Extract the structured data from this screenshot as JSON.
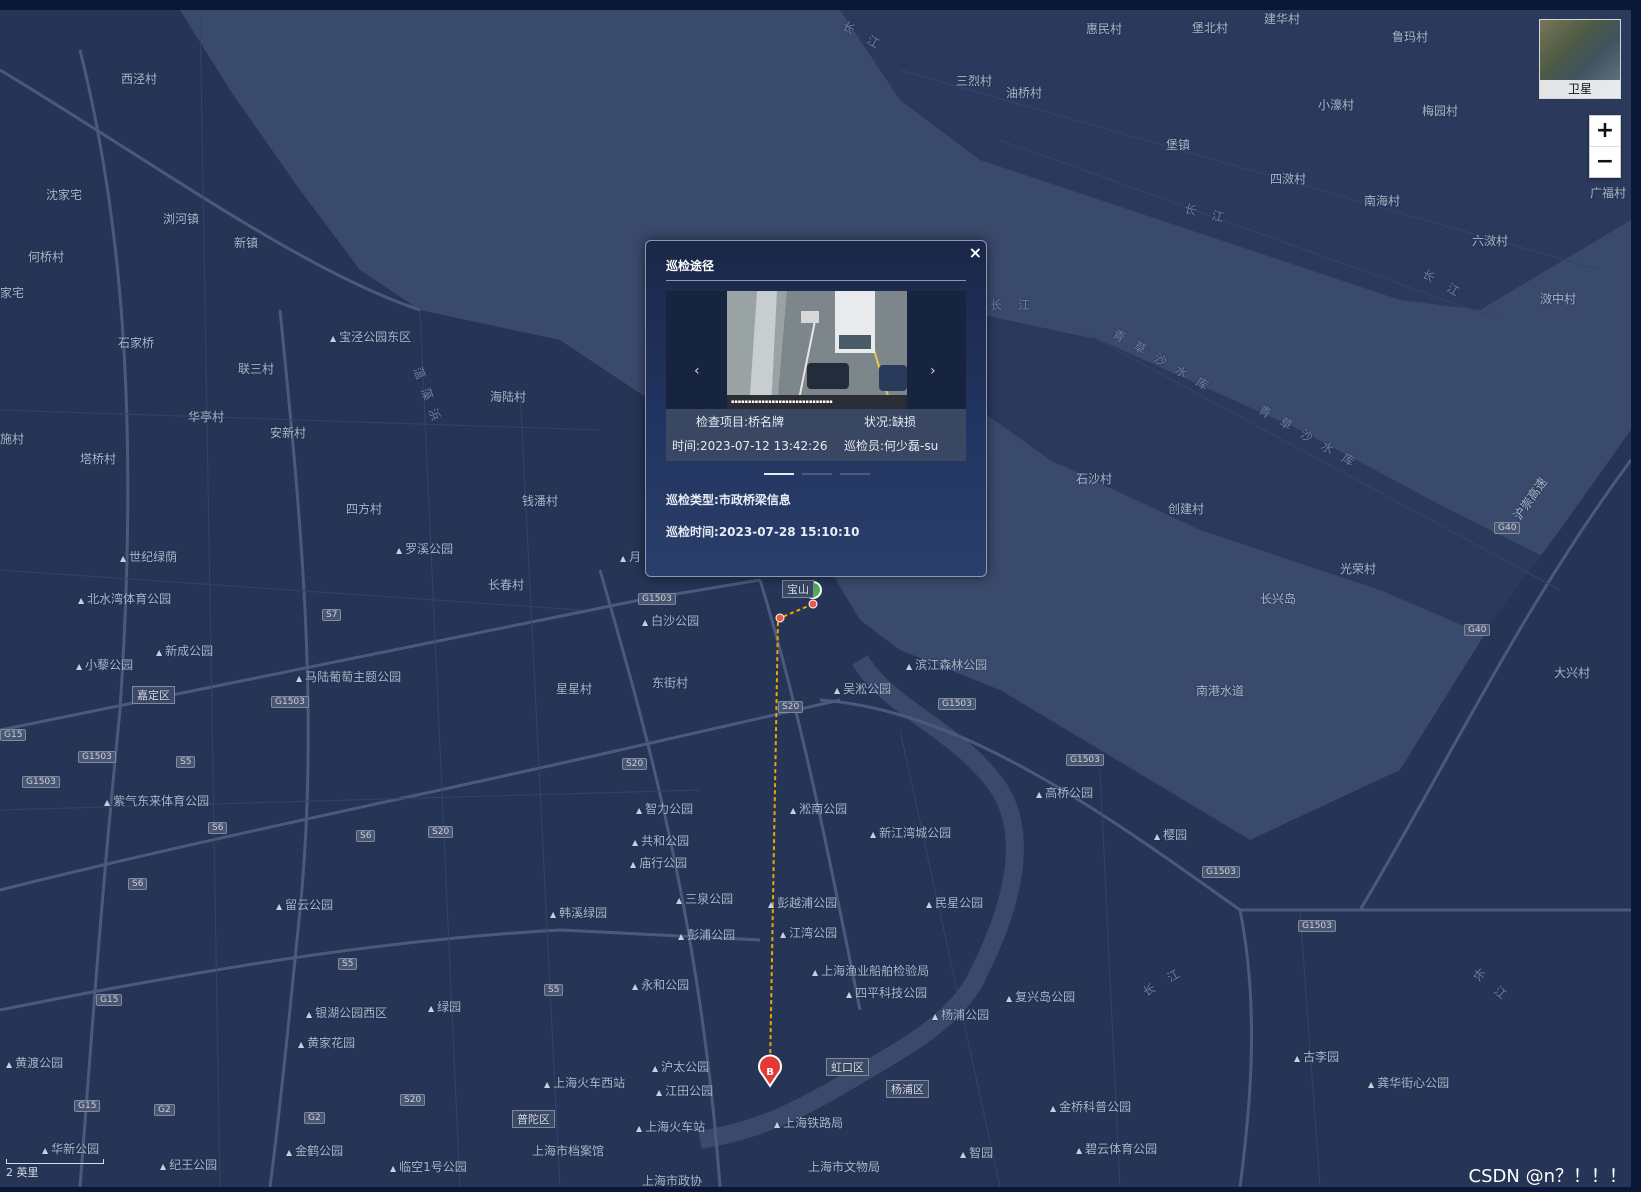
{
  "map": {
    "places": [
      {
        "name": "西泾村",
        "kind": "village"
      },
      {
        "name": "沈家宅",
        "kind": "village"
      },
      {
        "name": "浏河镇",
        "kind": "village"
      },
      {
        "name": "新镇",
        "kind": "village"
      },
      {
        "name": "何桥村",
        "kind": "village"
      },
      {
        "name": "家宅",
        "kind": "village"
      },
      {
        "name": "石家桥",
        "kind": "village"
      },
      {
        "name": "联三村",
        "kind": "village"
      },
      {
        "name": "宝泾公园东区",
        "kind": "poi"
      },
      {
        "name": "海陆村",
        "kind": "village"
      },
      {
        "name": "华亭村",
        "kind": "village"
      },
      {
        "name": "安新村",
        "kind": "village"
      },
      {
        "name": "施村",
        "kind": "village"
      },
      {
        "name": "塔桥村",
        "kind": "village"
      },
      {
        "name": "四方村",
        "kind": "village"
      },
      {
        "name": "钱潘村",
        "kind": "village"
      },
      {
        "name": "世纪绿荫",
        "kind": "poi"
      },
      {
        "name": "罗溪公园",
        "kind": "poi"
      },
      {
        "name": "长春村",
        "kind": "village"
      },
      {
        "name": "北水湾体育公园",
        "kind": "poi"
      },
      {
        "name": "白沙公园",
        "kind": "poi"
      },
      {
        "name": "小藜公园",
        "kind": "poi"
      },
      {
        "name": "新成公园",
        "kind": "poi"
      },
      {
        "name": "马陆葡萄主题公园",
        "kind": "poi"
      },
      {
        "name": "东街村",
        "kind": "village"
      },
      {
        "name": "星星村",
        "kind": "village"
      },
      {
        "name": "滨江森林公园",
        "kind": "poi"
      },
      {
        "name": "吴淞公园",
        "kind": "poi"
      },
      {
        "name": "紫气东来体育公园",
        "kind": "poi"
      },
      {
        "name": "智力公园",
        "kind": "poi"
      },
      {
        "name": "共和公园",
        "kind": "poi"
      },
      {
        "name": "庙行公园",
        "kind": "poi"
      },
      {
        "name": "淞南公园",
        "kind": "poi"
      },
      {
        "name": "新江湾城公园",
        "kind": "poi"
      },
      {
        "name": "高桥公园",
        "kind": "poi"
      },
      {
        "name": "留云公园",
        "kind": "poi"
      },
      {
        "name": "韩溪绿园",
        "kind": "poi"
      },
      {
        "name": "三泉公园",
        "kind": "poi"
      },
      {
        "name": "彭越浦公园",
        "kind": "poi"
      },
      {
        "name": "彭浦公园",
        "kind": "poi"
      },
      {
        "name": "江湾公园",
        "kind": "poi"
      },
      {
        "name": "民星公园",
        "kind": "poi"
      },
      {
        "name": "上海渔业船舶检验局",
        "kind": "poi"
      },
      {
        "name": "四平科技公园",
        "kind": "poi"
      },
      {
        "name": "杨浦公园",
        "kind": "poi"
      },
      {
        "name": "复兴岛公园",
        "kind": "poi"
      },
      {
        "name": "永和公园",
        "kind": "poi"
      },
      {
        "name": "银湖公园西区",
        "kind": "poi"
      },
      {
        "name": "绿园",
        "kind": "poi"
      },
      {
        "name": "黄家花园",
        "kind": "poi"
      },
      {
        "name": "黄渡公园",
        "kind": "poi"
      },
      {
        "name": "沪太公园",
        "kind": "poi"
      },
      {
        "name": "上海火车西站",
        "kind": "poi"
      },
      {
        "name": "江田公园",
        "kind": "poi"
      },
      {
        "name": "上海火车站",
        "kind": "poi"
      },
      {
        "name": "上海铁路局",
        "kind": "poi"
      },
      {
        "name": "金桥科普公园",
        "kind": "poi"
      },
      {
        "name": "碧云体育公园",
        "kind": "poi"
      },
      {
        "name": "古李园",
        "kind": "poi"
      },
      {
        "name": "龚华街心公园",
        "kind": "poi"
      },
      {
        "name": "华新公园",
        "kind": "poi"
      },
      {
        "name": "金鹤公园",
        "kind": "poi"
      },
      {
        "name": "纪王公园",
        "kind": "poi"
      },
      {
        "name": "临空1号公园",
        "kind": "poi"
      },
      {
        "name": "上海市档案馆",
        "kind": "poi"
      },
      {
        "name": "上海市文物局",
        "kind": "poi"
      },
      {
        "name": "上海市政协",
        "kind": "poi"
      },
      {
        "name": "智园",
        "kind": "poi"
      },
      {
        "name": "惠民村",
        "kind": "village"
      },
      {
        "name": "堡北村",
        "kind": "village"
      },
      {
        "name": "建华村",
        "kind": "village"
      },
      {
        "name": "鲁玛村",
        "kind": "village"
      },
      {
        "name": "三烈村",
        "kind": "village"
      },
      {
        "name": "油桥村",
        "kind": "village"
      },
      {
        "name": "小濠村",
        "kind": "village"
      },
      {
        "name": "梅园村",
        "kind": "village"
      },
      {
        "name": "堡镇",
        "kind": "village"
      },
      {
        "name": "四滧村",
        "kind": "village"
      },
      {
        "name": "南海村",
        "kind": "village"
      },
      {
        "name": "广福村",
        "kind": "village"
      },
      {
        "name": "六滧村",
        "kind": "village"
      },
      {
        "name": "滧中村",
        "kind": "village"
      },
      {
        "name": "石沙村",
        "kind": "village"
      },
      {
        "name": "创建村",
        "kind": "village"
      },
      {
        "name": "光荣村",
        "kind": "village"
      },
      {
        "name": "长兴岛",
        "kind": "village"
      },
      {
        "name": "南港水道",
        "kind": "village"
      },
      {
        "name": "大兴村",
        "kind": "village"
      },
      {
        "name": "樱园",
        "kind": "poi"
      },
      {
        "name": "月",
        "kind": "poi"
      }
    ],
    "districts": [
      "嘉定区",
      "宝山",
      "虹口区",
      "杨浦区",
      "普陀区"
    ],
    "rivers": [
      "长江",
      "长江",
      "长江",
      "长江",
      "长江",
      "青草沙水库",
      "青草沙水库",
      "蕰藻浜",
      "长江",
      "沪崇高速"
    ],
    "road_shields": [
      "G1503",
      "S7",
      "G1503",
      "G1503",
      "S20",
      "S20",
      "G1503",
      "S5",
      "S6",
      "S6",
      "S20",
      "S6",
      "S5",
      "S5",
      "G15",
      "G15",
      "G2",
      "G2",
      "S20",
      "G1503",
      "G1503",
      "G1503",
      "G40",
      "G40",
      "G1503",
      "G15"
    ],
    "route": {
      "start_marker": "A",
      "end_marker": "B",
      "color": "#f0a500"
    }
  },
  "controls": {
    "satellite_label": "卫星",
    "zoom_in": "+",
    "zoom_out": "−",
    "scale_label": "2 英里"
  },
  "popup": {
    "title": "巡检途径",
    "close": "×",
    "carousel": {
      "prev": "‹",
      "next": "›",
      "item_label": "检查项目:桥名牌",
      "status_label": "状况:缺损",
      "time_label": "时间:2023-07-12 13:42:26",
      "inspector_label": "巡检员:何少磊-su",
      "pages": 3,
      "active_page": 1
    },
    "type_label": "巡检类型:",
    "type_value": "市政桥梁信息",
    "time_label": "巡检时间:",
    "time_value": "2023-07-28 15:10:10"
  },
  "credit": "CSDN @n？！！！",
  "colors": {
    "land": "#263556",
    "water": "#3a4a6c",
    "road": "#4a5a7e",
    "popup_bg": "#1e2d52"
  }
}
